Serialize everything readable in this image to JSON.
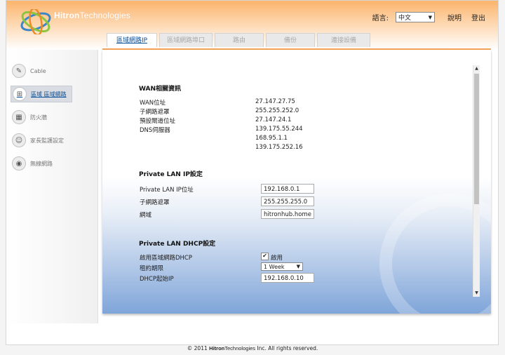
{
  "brand": {
    "part1": "Hitron",
    "part2": "Technologies"
  },
  "header": {
    "language_label": "語言:",
    "language_value": "中文",
    "help": "說明",
    "logout": "登出"
  },
  "tabs": [
    {
      "label": "區域網路IP",
      "active": true
    },
    {
      "label": "區域網路埠口設定",
      "active": false
    },
    {
      "label": "路由",
      "active": false
    },
    {
      "label": "備份",
      "active": false
    },
    {
      "label": "連接設備",
      "active": false
    }
  ],
  "sidebar": {
    "items": [
      {
        "label": "Cable",
        "icon": "wrench-icon",
        "active": false
      },
      {
        "label": "區域 區域網路",
        "icon": "network-icon",
        "active": true
      },
      {
        "label": "防火牆",
        "icon": "firewall-icon",
        "active": false
      },
      {
        "label": "家長監護設定",
        "icon": "parents-icon",
        "active": false
      },
      {
        "label": "無線網路",
        "icon": "wireless-icon",
        "active": false
      }
    ]
  },
  "wan": {
    "title": "WAN相關資訊",
    "rows": [
      {
        "label": "WAN位址",
        "value": "27.147.27.75"
      },
      {
        "label": "子網路遮罩",
        "value": "255.255.252.0"
      },
      {
        "label": "預設閘道位址",
        "value": "27.147.24.1"
      },
      {
        "label": "DNS伺服器",
        "value": "139.175.55.244"
      }
    ],
    "dns_extra": [
      "168.95.1.1",
      "139.175.252.16"
    ]
  },
  "lan": {
    "title": "Private LAN IP設定",
    "rows": [
      {
        "label": "Private LAN IP位址",
        "value": "192.168.0.1"
      },
      {
        "label": "子網路遮罩",
        "value": "255.255.255.0"
      },
      {
        "label": "網域",
        "value": "hitronhub.home"
      }
    ]
  },
  "dhcp": {
    "title": "Private LAN DHCP設定",
    "enable_label": "啟用區域網路DHCP",
    "enable_check_label": "啟用",
    "enabled": true,
    "lease_label": "租約期限",
    "lease_value": "1 Week",
    "start_label": "DHCP起始IP",
    "start_value": "192.168.0.10"
  },
  "footer": {
    "prefix": "© 2011",
    "brand1": "Hitron",
    "brand2": "Technologies",
    "suffix": "Inc.  All rights reserved."
  },
  "colors": {
    "accent_orange": "#f4a35a",
    "link_blue": "#0a4f9a",
    "content_blue": "#7fa5d9"
  }
}
